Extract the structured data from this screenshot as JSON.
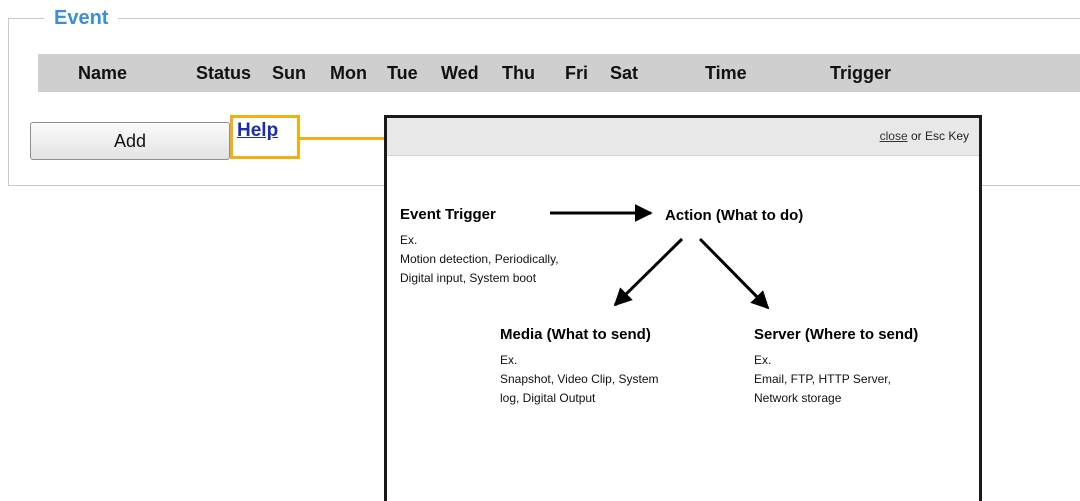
{
  "event_section": {
    "legend": "Event",
    "columns": [
      "Name",
      "Status",
      "Sun",
      "Mon",
      "Tue",
      "Wed",
      "Thu",
      "Fri",
      "Sat",
      "Time",
      "Trigger"
    ],
    "add_label": "Add",
    "help_label": "Help"
  },
  "popup": {
    "close_link": "close",
    "close_suffix": " or Esc Key",
    "event_trigger": {
      "title": "Event Trigger",
      "lines": [
        "Ex.",
        "Motion detection, Periodically,",
        "Digital input, System boot"
      ]
    },
    "action": {
      "title": "Action (What to do)"
    },
    "media": {
      "title": "Media (What to send)",
      "lines": [
        "Ex.",
        "Snapshot, Video Clip, System",
        "log, Digital Output"
      ]
    },
    "server": {
      "title": "Server (Where to send)",
      "lines": [
        "Ex.",
        "Email, FTP, HTTP Server,",
        "Network storage"
      ]
    }
  },
  "colors": {
    "legend": "#3a8fd8",
    "highlight": "#f2ae14",
    "header_bg": "#cfcfcf",
    "link": "#1a2fa8"
  }
}
